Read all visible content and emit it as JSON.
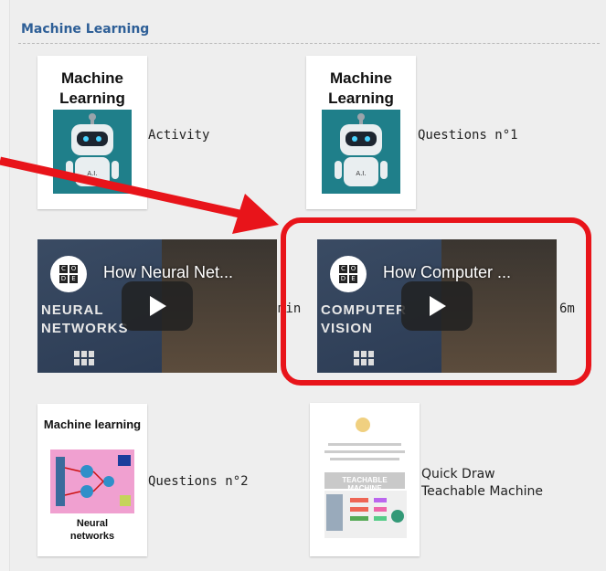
{
  "section": {
    "title": "Machine Learning"
  },
  "items": [
    {
      "label": "Activity",
      "thumb_title": "Machine Learning",
      "thumb_caption": "A.I."
    },
    {
      "label": "Questions n°1",
      "thumb_title": "Machine Learning",
      "thumb_caption": "A.I."
    },
    {
      "video_title": "How Neural Net...",
      "side_text": "NEURAL NETWORKS",
      "duration": "min",
      "logo_letters": [
        "C",
        "O",
        "D",
        "E"
      ]
    },
    {
      "video_title": "How Computer ...",
      "side_text": "COMPUTER VISION",
      "duration": "6m",
      "logo_letters": [
        "C",
        "O",
        "D",
        "E"
      ]
    },
    {
      "label": "Questions n°2",
      "thumb_title": "Machine learning",
      "thumb_footer": "Neural networks"
    },
    {
      "label_line1": "Quick Draw",
      "label_line2": "Teachable Machine",
      "thumb_banner": "TEACHABLE MACHINE"
    }
  ],
  "colors": {
    "accent": "#2e5f97",
    "highlight": "#e8141a",
    "robot_bg": "#1f7f8a"
  }
}
